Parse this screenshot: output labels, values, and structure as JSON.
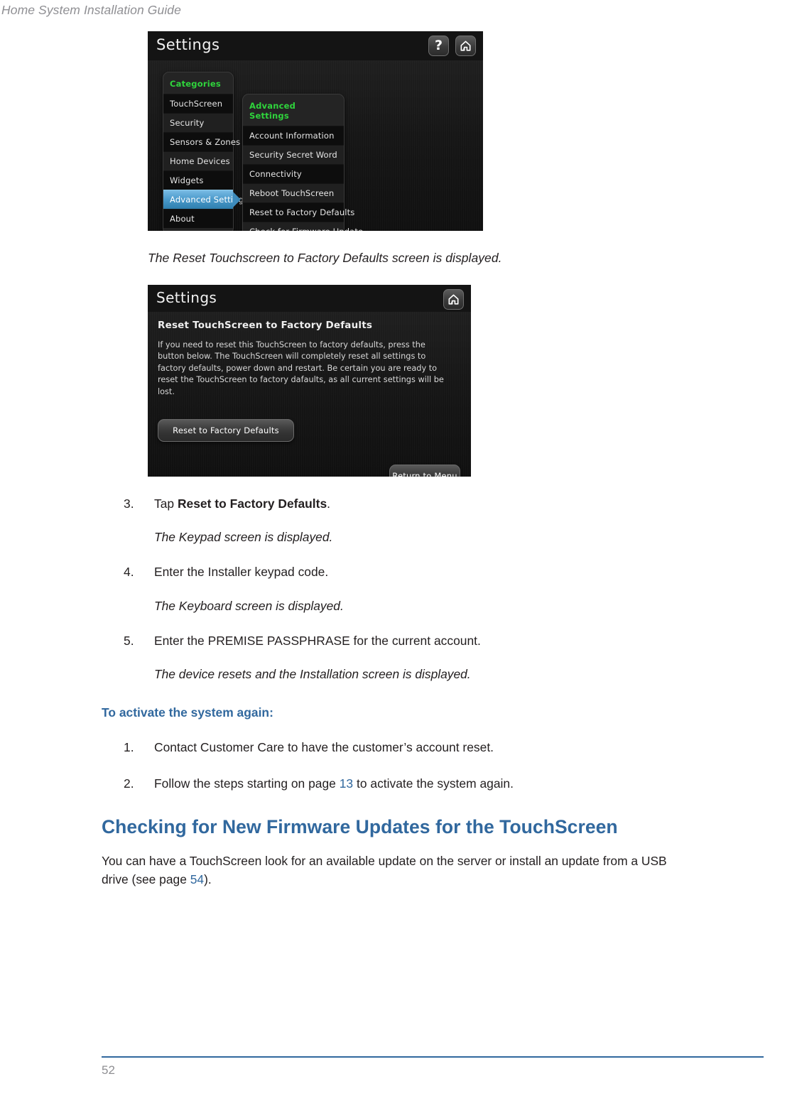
{
  "page": {
    "running_header": "Home System Installation Guide",
    "folio": "52"
  },
  "figure_settings_categories": {
    "titlebar": {
      "title": "Settings",
      "help_icon": "question-mark-icon",
      "home_icon": "home-icon"
    },
    "categories_panel": {
      "header": "Categories",
      "items": [
        {
          "label": "TouchScreen",
          "selected": false
        },
        {
          "label": "Security",
          "selected": false
        },
        {
          "label": "Sensors & Zones",
          "selected": false
        },
        {
          "label": "Home Devices",
          "selected": false
        },
        {
          "label": "Widgets",
          "selected": false
        },
        {
          "label": "Advanced Settings",
          "selected": true
        },
        {
          "label": "About",
          "selected": false
        }
      ]
    },
    "advanced_panel": {
      "header": "Advanced Settings",
      "items": [
        {
          "label": "Account Information"
        },
        {
          "label": "Security Secret Word"
        },
        {
          "label": "Connectivity"
        },
        {
          "label": "Reboot TouchScreen"
        },
        {
          "label": "Reset to Factory Defaults"
        },
        {
          "label": "Check for Firmware Update"
        }
      ]
    }
  },
  "caption_1": "The Reset Touchscreen to Factory Defaults screen is displayed.",
  "figure_reset_screen": {
    "titlebar": {
      "title": "Settings",
      "home_icon": "home-icon"
    },
    "heading": "Reset TouchScreen to Factory Defaults",
    "paragraph": "If you need to reset this TouchScreen to factory defaults, press the button below. The TouchScreen will completely reset all settings to factory defaults, power down and restart. Be certain you are ready to reset the TouchScreen to factory dafaults, as all current settings will be lost.",
    "reset_button": "Reset to Factory Defaults",
    "return_button": "Return to Menu"
  },
  "steps": [
    {
      "num": "3.",
      "text_before": "Tap ",
      "bold": "Reset to Factory Defaults",
      "text_after": ".",
      "result": "The Keypad screen is displayed."
    },
    {
      "num": "4.",
      "text_before": "Enter the Installer keypad code.",
      "bold": "",
      "text_after": "",
      "result": "The Keyboard screen is displayed."
    },
    {
      "num": "5.",
      "text_before": "Enter the PREMISE PASSPHRASE for the current account.",
      "bold": "",
      "text_after": "",
      "result": "The device resets and the Installation screen is displayed."
    }
  ],
  "activate_section": {
    "subheading": "To activate the system again:",
    "items": [
      {
        "num": "1.",
        "text_before": "Contact Customer Care to have the customer’s account reset.",
        "xref": "",
        "text_after": ""
      },
      {
        "num": "2.",
        "text_before": "Follow the steps starting on page ",
        "xref": "13",
        "text_after": " to activate the system again."
      }
    ]
  },
  "firmware_section": {
    "heading": "Checking for New Firmware Updates for the TouchScreen",
    "para_before": "You can have a TouchScreen look for an available update on the server or install an update from a USB drive (see page ",
    "para_xref": "54",
    "para_after": ")."
  },
  "colors": {
    "accent_blue": "#31689E",
    "header_gray": "#8F8F93",
    "body_black": "#231F20",
    "menu_green": "#2FD43C",
    "selection_blue": "#4B9ACB"
  }
}
